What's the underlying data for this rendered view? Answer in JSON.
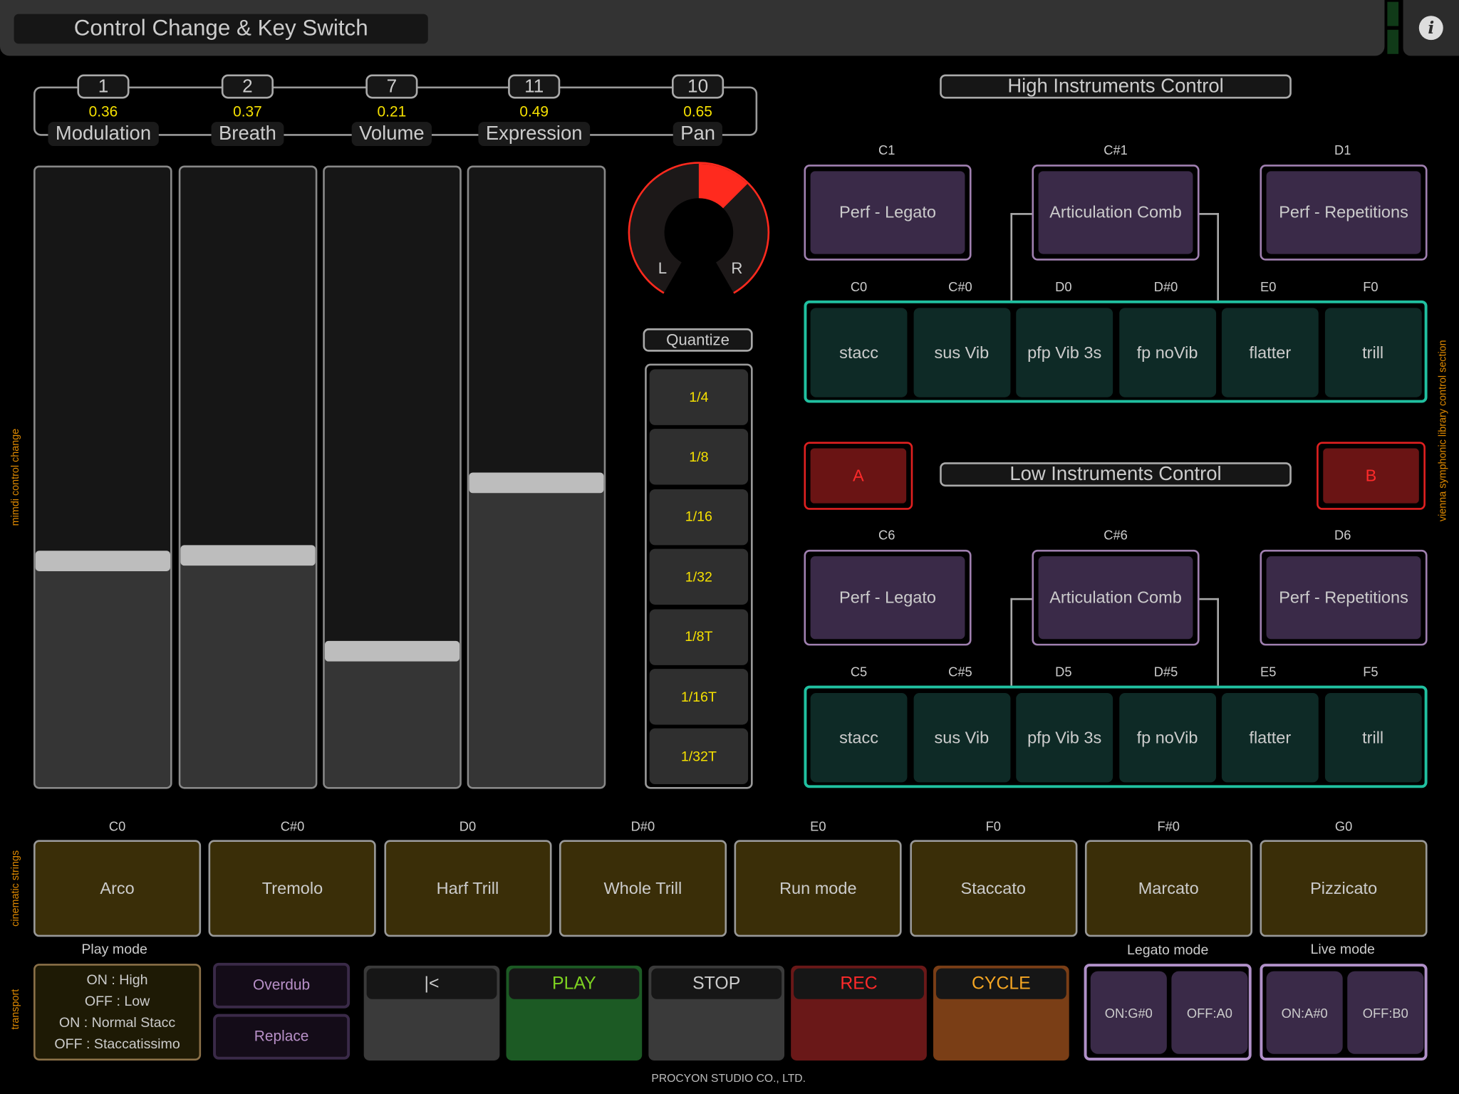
{
  "header": {
    "title": "Control Change & Key Switch",
    "info_icon": "info-icon"
  },
  "cc": [
    {
      "number": "1",
      "value": "0.36",
      "label": "Modulation",
      "level": 0.36
    },
    {
      "number": "2",
      "value": "0.37",
      "label": "Breath",
      "level": 0.37
    },
    {
      "number": "7",
      "value": "0.21",
      "label": "Volume",
      "level": 0.21
    },
    {
      "number": "11",
      "value": "0.49",
      "label": "Expression",
      "level": 0.49
    },
    {
      "number": "10",
      "value": "0.65",
      "label": "Pan",
      "level": 0.65
    }
  ],
  "pan": {
    "left": "L",
    "right": "R",
    "color": "#ff2a1e"
  },
  "quantize": {
    "label": "Quantize",
    "options": [
      "1/4",
      "1/8",
      "1/16",
      "1/32",
      "1/8T",
      "1/16T",
      "1/32T"
    ]
  },
  "side_labels": {
    "cc": "mimdi control change",
    "vsl": "vienna symphonic library control section",
    "strings": "cinematic strings",
    "transport": "transport"
  },
  "high": {
    "title": "High Instruments Control",
    "perf": [
      {
        "note": "C1",
        "label": "Perf - Legato"
      },
      {
        "note": "C#1",
        "label": "Articulation Comb"
      },
      {
        "note": "D1",
        "label": "Perf - Repetitions"
      }
    ],
    "arts": [
      {
        "note": "C0",
        "label": "stacc"
      },
      {
        "note": "C#0",
        "label": "sus Vib"
      },
      {
        "note": "D0",
        "label": "pfp Vib 3s"
      },
      {
        "note": "D#0",
        "label": "fp noVib"
      },
      {
        "note": "E0",
        "label": "flatter"
      },
      {
        "note": "F0",
        "label": "trill"
      }
    ]
  },
  "ab": {
    "a": "A",
    "b": "B"
  },
  "low": {
    "title": "Low Instruments Control",
    "perf": [
      {
        "note": "C6",
        "label": "Perf - Legato"
      },
      {
        "note": "C#6",
        "label": "Articulation Comb"
      },
      {
        "note": "D6",
        "label": "Perf - Repetitions"
      }
    ],
    "arts": [
      {
        "note": "C5",
        "label": "stacc"
      },
      {
        "note": "C#5",
        "label": "sus Vib"
      },
      {
        "note": "D5",
        "label": "pfp Vib 3s"
      },
      {
        "note": "D#5",
        "label": "fp noVib"
      },
      {
        "note": "E5",
        "label": "flatter"
      },
      {
        "note": "F5",
        "label": "trill"
      }
    ]
  },
  "keyswitch": [
    {
      "note": "C0",
      "label": "Arco"
    },
    {
      "note": "C#0",
      "label": "Tremolo"
    },
    {
      "note": "D0",
      "label": "Harf Trill"
    },
    {
      "note": "D#0",
      "label": "Whole Trill"
    },
    {
      "note": "E0",
      "label": "Run mode"
    },
    {
      "note": "F0",
      "label": "Staccato"
    },
    {
      "note": "F#0",
      "label": "Marcato"
    },
    {
      "note": "G0",
      "label": "Pizzicato"
    }
  ],
  "play_mode": {
    "label": "Play mode",
    "lines": [
      "ON : High",
      "OFF : Low",
      "ON : Normal Stacc",
      "OFF : Staccatissimo"
    ]
  },
  "record_mode": {
    "overdub": "Overdub",
    "replace": "Replace"
  },
  "transport": [
    {
      "label": "|<",
      "color": "#3a3a3a",
      "text": "#ccc"
    },
    {
      "label": "PLAY",
      "color": "#1c5a24",
      "text": "#7ed321"
    },
    {
      "label": "STOP",
      "color": "#3a3a3a",
      "text": "#ccc"
    },
    {
      "label": "REC",
      "color": "#6a1818",
      "text": "#ff2a2a"
    },
    {
      "label": "CYCLE",
      "color": "#7a3e16",
      "text": "#f5a623"
    }
  ],
  "legato_mode": {
    "label": "Legato mode",
    "on": "ON:G#0",
    "off": "OFF:A0"
  },
  "live_mode": {
    "label": "Live mode",
    "on": "ON:A#0",
    "off": "OFF:B0"
  },
  "footer": "PROCYON STUDIO CO., LTD."
}
